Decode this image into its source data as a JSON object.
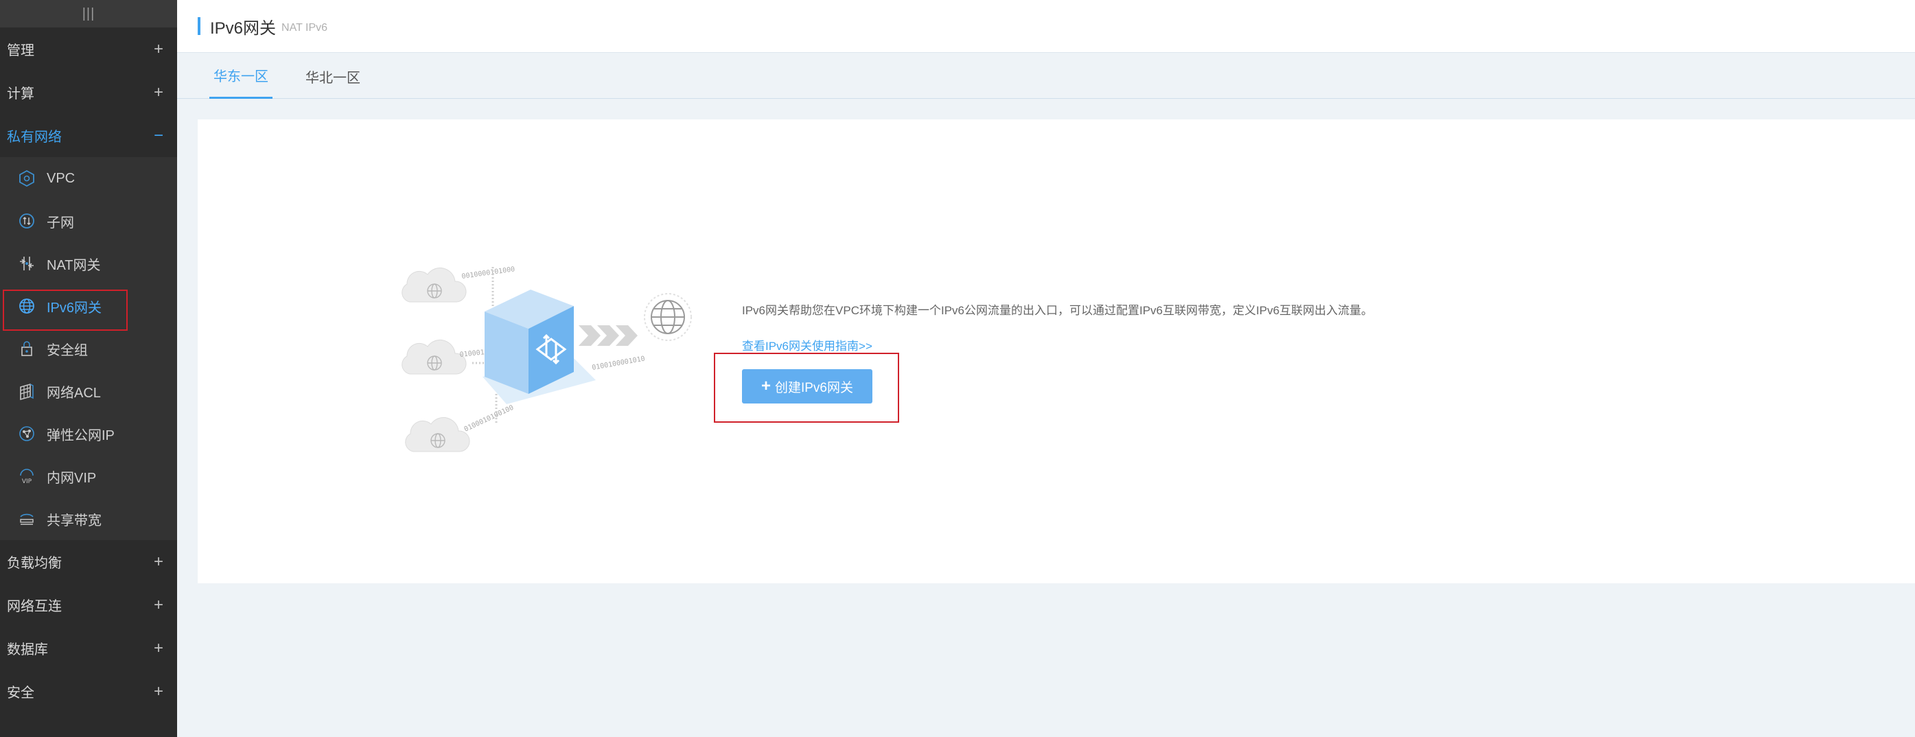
{
  "sidebar": {
    "handle": "|||",
    "groups_top": [
      {
        "label": "管理",
        "toggle": "+"
      },
      {
        "label": "计算",
        "toggle": "+"
      }
    ],
    "active_group": {
      "label": "私有网络",
      "toggle": "−"
    },
    "items": [
      {
        "label": "VPC",
        "icon": "vpc-icon"
      },
      {
        "label": "子网",
        "icon": "subnet-icon"
      },
      {
        "label": "NAT网关",
        "icon": "nat-gateway-icon"
      },
      {
        "label": "IPv6网关",
        "icon": "globe-icon"
      },
      {
        "label": "安全组",
        "icon": "lock-icon"
      },
      {
        "label": "网络ACL",
        "icon": "firewall-icon"
      },
      {
        "label": "弹性公网IP",
        "icon": "network-nodes-icon"
      },
      {
        "label": "内网VIP",
        "icon": "vip-icon"
      },
      {
        "label": "共享带宽",
        "icon": "bandwidth-icon"
      }
    ],
    "groups_bottom": [
      {
        "label": "负载均衡",
        "toggle": "+"
      },
      {
        "label": "网络互连",
        "toggle": "+"
      },
      {
        "label": "数据库",
        "toggle": "+"
      },
      {
        "label": "安全",
        "toggle": "+"
      }
    ]
  },
  "header": {
    "title": "IPv6网关",
    "subtitle": "NAT IPv6"
  },
  "tabs": [
    {
      "label": "华东一区",
      "active": true
    },
    {
      "label": "华北一区",
      "active": false
    }
  ],
  "main": {
    "description": "IPv6网关帮助您在VPC环境下构建一个IPv6公网流量的出入口，可以通过配置IPv6互联网带宽，定义IPv6互联网出入流量。",
    "guide_link": "查看IPv6网关使用指南>>",
    "create_button": {
      "plus": "+",
      "label": "创建IPv6网关"
    },
    "illustration_text": {
      "binary1": "0010000101000",
      "binary2": "0100010010100",
      "binary3": "0100010100100",
      "binary4": "0100100001010"
    }
  },
  "colors": {
    "accent": "#3fa3f0",
    "sidebar_bg": "#2b2b2b",
    "highlight_border": "#d0202a",
    "button_bg": "#62aef0"
  }
}
